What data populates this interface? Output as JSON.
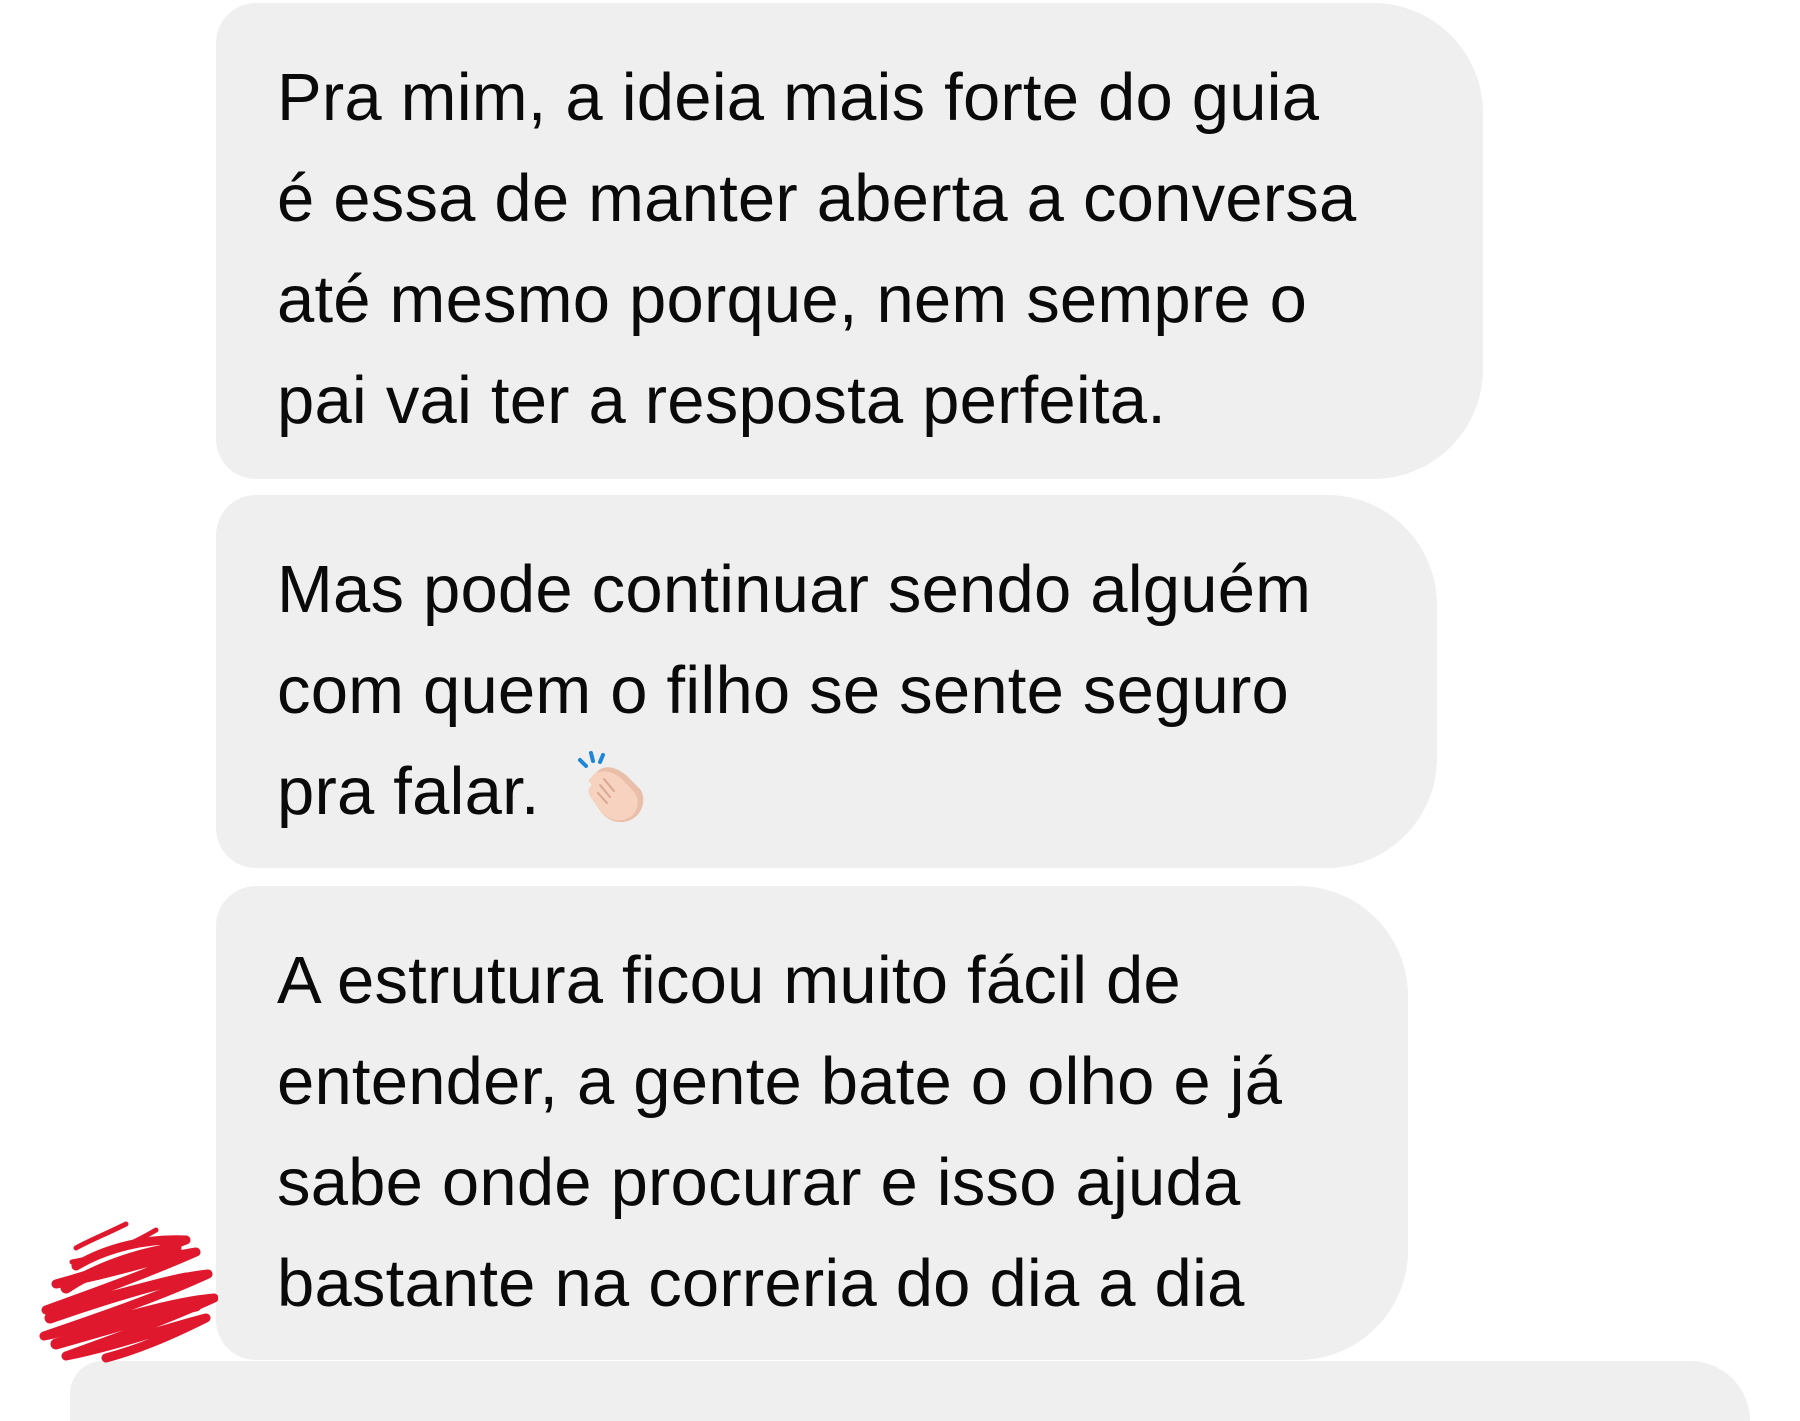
{
  "messages": [
    {
      "lines": [
        "Pra mim, a ideia mais forte do guia",
        "é essa de manter aberta a conversa",
        "até mesmo porque, nem sempre o",
        "pai vai ter a resposta perfeita."
      ]
    },
    {
      "lines": [
        "Mas pode continuar sendo alguém",
        "com quem o filho se sente seguro",
        "pra falar."
      ],
      "emoji": "clapping-hands-icon"
    },
    {
      "lines": [
        "A estrutura ficou muito fácil de",
        "entender, a gente bate o olho e já",
        "sabe onde procurar e isso ajuda",
        "bastante na correria do dia a dia"
      ]
    }
  ],
  "colors": {
    "bubble_background": "#efefef",
    "text": "#0a0a0a",
    "redaction": "#e0182d",
    "emoji_skin": "#f6d2bf",
    "emoji_accent": "#1d86d6"
  }
}
